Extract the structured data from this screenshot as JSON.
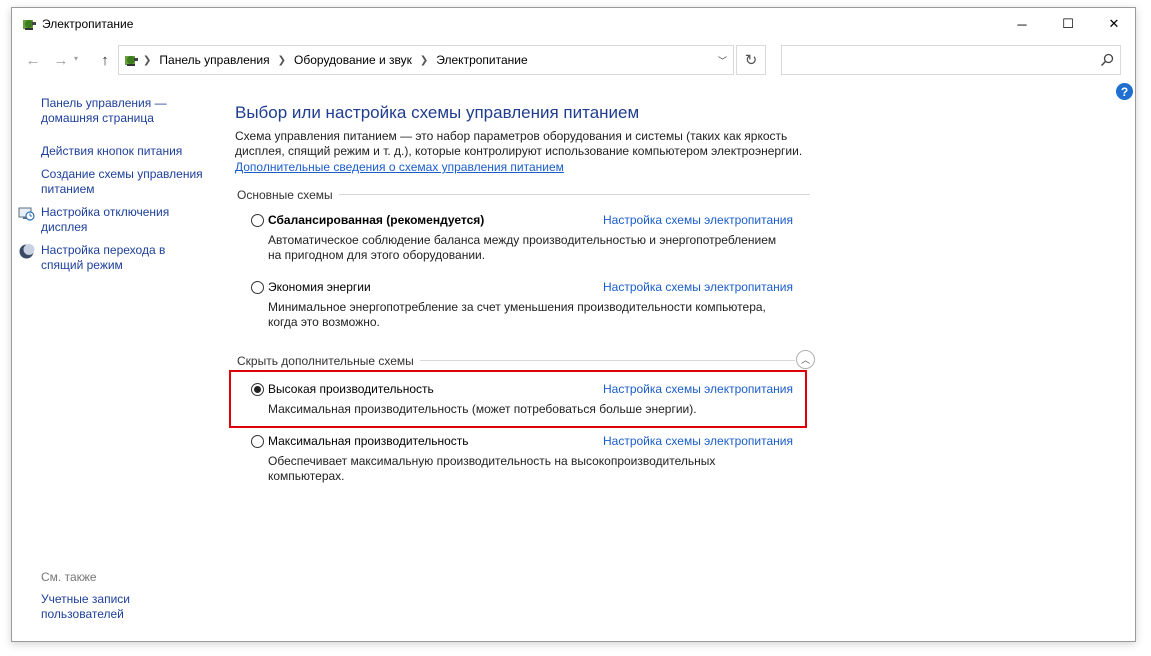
{
  "window": {
    "title": "Электропитание"
  },
  "caption": {
    "minimize": "─",
    "maximize": "☐",
    "close": "✕"
  },
  "nav": {
    "back": "←",
    "forward": "→",
    "up": "↑",
    "refresh": "↻",
    "breadcrumbs": [
      "Панель управления",
      "Оборудование и звук",
      "Электропитание"
    ],
    "search_placeholder": ""
  },
  "sidebar": {
    "home_link": [
      "Панель управления —",
      "домашняя страница"
    ],
    "power_buttons": "Действия кнопок питания",
    "create_plan": [
      "Создание схемы управления",
      "питанием"
    ],
    "display_off": [
      "Настройка отключения",
      "дисплея"
    ],
    "sleep": [
      "Настройка перехода в",
      "спящий режим"
    ],
    "see_also_title": "См. также",
    "user_accounts": [
      "Учетные записи",
      "пользователей"
    ]
  },
  "main": {
    "title": "Выбор или настройка схемы управления питанием",
    "description": [
      "Схема управления питанием — это набор параметров оборудования и системы (таких как яркость",
      "дисплея, спящий режим и т. д.), которые контролируют использование компьютером электроэнергии."
    ],
    "more_link": "Дополнительные сведения о схемах управления питанием",
    "primary_group": "Основные схемы",
    "hidden_group": "Скрыть дополнительные схемы",
    "plans": [
      {
        "name": "Сбалансированная (рекомендуется)",
        "desc1": "Автоматическое соблюдение баланса между производительностью и энергопотреблением",
        "desc2": "на пригодном для этого оборудовании.",
        "link": "Настройка схемы электропитания",
        "selected": false
      },
      {
        "name": "Экономия энергии",
        "desc1": "Минимальное энергопотребление за счет уменьшения производительности компьютера,",
        "desc2": "когда это возможно.",
        "link": "Настройка схемы электропитания",
        "selected": false
      },
      {
        "name": "Высокая производительность",
        "desc1": "Максимальная производительность (может потребоваться больше энергии).",
        "link": "Настройка схемы электропитания",
        "selected": true
      },
      {
        "name": "Максимальная производительность",
        "desc1": "Обеспечивает максимальную производительность на высокопроизводительных",
        "desc2": "компьютерах.",
        "link": "Настройка схемы электропитания",
        "selected": false
      }
    ]
  },
  "colors": {
    "highlight": "#e0000a",
    "link": "#1a5dc9",
    "title": "#1f3d8e",
    "help": "#1e6fd0"
  },
  "help_label": "?"
}
